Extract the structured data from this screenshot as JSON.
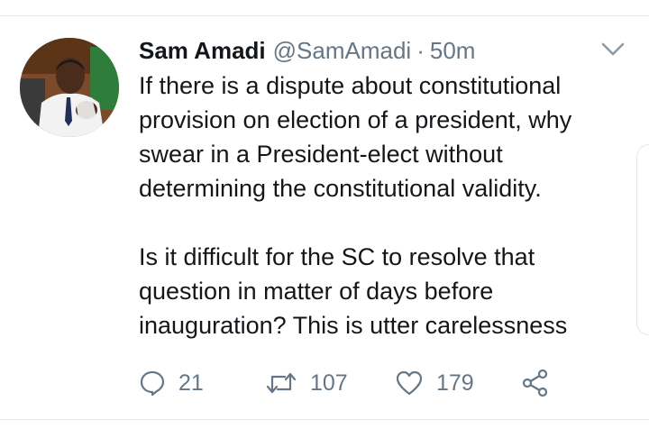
{
  "tweet": {
    "author_name": "Sam Amadi",
    "handle": "@SamAmadi",
    "separator": "·",
    "time": "50m",
    "paragraphs": [
      "If there is a dispute about constitutional provision on election of a president, why swear in a President-elect without determining the constitutional validity.",
      "Is it difficult for the SC to resolve that question in matter of days before inauguration? This is utter carelessness"
    ]
  },
  "actions": {
    "reply": {
      "icon": "reply-icon",
      "count": "21"
    },
    "retweet": {
      "icon": "retweet-icon",
      "count": "107"
    },
    "like": {
      "icon": "heart-icon",
      "count": "179"
    },
    "share": {
      "icon": "share-icon"
    }
  },
  "colors": {
    "text": "#14171a",
    "secondary": "#657786",
    "divider": "#e1e8ed"
  }
}
